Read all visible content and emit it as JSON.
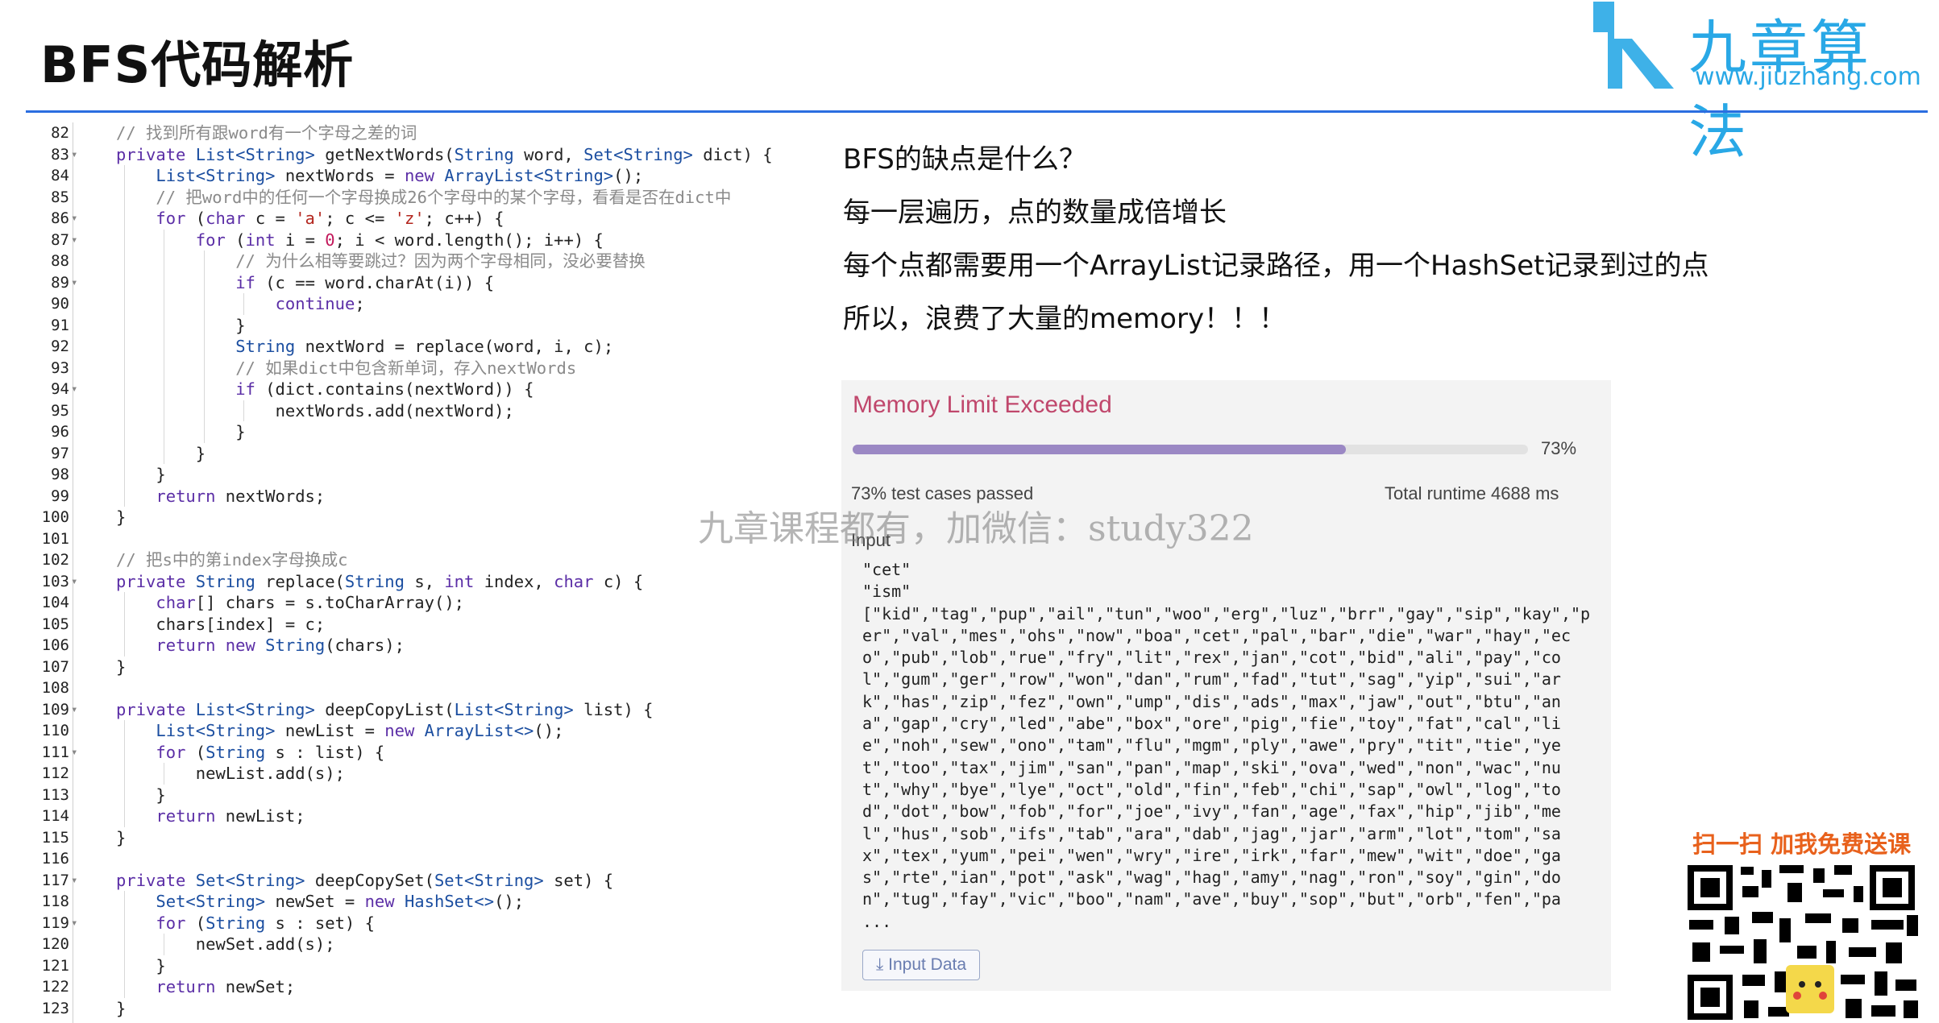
{
  "title": "BFS代码解析",
  "logo": {
    "name_cn": "九章算法",
    "url": "www.jiuzhang.com"
  },
  "code": {
    "lines": [
      {
        "n": "82",
        "fold": false,
        "indent": 1,
        "guides": 0,
        "tokens": [
          [
            "com",
            "// 找到所有跟word有一个字母之差的词"
          ]
        ]
      },
      {
        "n": "83",
        "fold": true,
        "indent": 1,
        "guides": 0,
        "tokens": [
          [
            "kw",
            "private "
          ],
          [
            "ty",
            "List<String> "
          ],
          [
            "",
            "getNextWords("
          ],
          [
            "ty",
            "String "
          ],
          [
            "",
            "word, "
          ],
          [
            "ty",
            "Set<String> "
          ],
          [
            "",
            "dict) {"
          ]
        ]
      },
      {
        "n": "84",
        "fold": false,
        "indent": 2,
        "guides": 1,
        "tokens": [
          [
            "ty",
            "List<String> "
          ],
          [
            "",
            "nextWords = "
          ],
          [
            "kw",
            "new "
          ],
          [
            "ty",
            "ArrayList<String>"
          ],
          [
            "",
            "();"
          ]
        ]
      },
      {
        "n": "85",
        "fold": false,
        "indent": 2,
        "guides": 1,
        "tokens": [
          [
            "com",
            "// 把word中的任何一个字母换成26个字母中的某个字母，看看是否在dict中"
          ]
        ]
      },
      {
        "n": "86",
        "fold": true,
        "indent": 2,
        "guides": 1,
        "tokens": [
          [
            "kw",
            "for "
          ],
          [
            "",
            "("
          ],
          [
            "kw",
            "char "
          ],
          [
            "",
            "c = "
          ],
          [
            "str",
            "'a'"
          ],
          [
            "",
            "; c <= "
          ],
          [
            "str",
            "'z'"
          ],
          [
            "",
            "; c++) {"
          ]
        ]
      },
      {
        "n": "87",
        "fold": true,
        "indent": 3,
        "guides": 2,
        "tokens": [
          [
            "kw",
            "for "
          ],
          [
            "",
            "("
          ],
          [
            "kw",
            "int "
          ],
          [
            "",
            "i = "
          ],
          [
            "num",
            "0"
          ],
          [
            "",
            "; i < word.length(); i++) {"
          ]
        ]
      },
      {
        "n": "88",
        "fold": false,
        "indent": 4,
        "guides": 3,
        "tokens": [
          [
            "com",
            "// 为什么相等要跳过？因为两个字母相同，没必要替换"
          ]
        ]
      },
      {
        "n": "89",
        "fold": true,
        "indent": 4,
        "guides": 3,
        "tokens": [
          [
            "kw",
            "if "
          ],
          [
            "",
            "(c == word.charAt(i)) {"
          ]
        ]
      },
      {
        "n": "90",
        "fold": false,
        "indent": 5,
        "guides": 4,
        "tokens": [
          [
            "kw",
            "continue"
          ],
          [
            "",
            ";"
          ]
        ]
      },
      {
        "n": "91",
        "fold": false,
        "indent": 4,
        "guides": 3,
        "tokens": [
          [
            "",
            "}"
          ]
        ]
      },
      {
        "n": "92",
        "fold": false,
        "indent": 4,
        "guides": 3,
        "tokens": [
          [
            "ty",
            "String "
          ],
          [
            "",
            "nextWord = replace(word, i, c);"
          ]
        ]
      },
      {
        "n": "93",
        "fold": false,
        "indent": 4,
        "guides": 3,
        "tokens": [
          [
            "com",
            "// 如果dict中包含新单词，存入nextWords"
          ]
        ]
      },
      {
        "n": "94",
        "fold": true,
        "indent": 4,
        "guides": 3,
        "tokens": [
          [
            "kw",
            "if "
          ],
          [
            "",
            "(dict.contains(nextWord)) {"
          ]
        ]
      },
      {
        "n": "95",
        "fold": false,
        "indent": 5,
        "guides": 4,
        "tokens": [
          [
            "",
            "nextWords.add(nextWord);"
          ]
        ]
      },
      {
        "n": "96",
        "fold": false,
        "indent": 4,
        "guides": 3,
        "tokens": [
          [
            "",
            "}"
          ]
        ]
      },
      {
        "n": "97",
        "fold": false,
        "indent": 3,
        "guides": 2,
        "tokens": [
          [
            "",
            "}"
          ]
        ]
      },
      {
        "n": "98",
        "fold": false,
        "indent": 2,
        "guides": 1,
        "tokens": [
          [
            "",
            "}"
          ]
        ]
      },
      {
        "n": "99",
        "fold": false,
        "indent": 2,
        "guides": 1,
        "tokens": [
          [
            "kw",
            "return "
          ],
          [
            "",
            "nextWords;"
          ]
        ]
      },
      {
        "n": "100",
        "fold": false,
        "indent": 1,
        "guides": 0,
        "tokens": [
          [
            "",
            "}"
          ]
        ]
      },
      {
        "n": "101",
        "fold": false,
        "indent": 1,
        "guides": 0,
        "tokens": []
      },
      {
        "n": "102",
        "fold": false,
        "indent": 1,
        "guides": 0,
        "tokens": [
          [
            "com",
            "// 把s中的第index字母换成c"
          ]
        ]
      },
      {
        "n": "103",
        "fold": true,
        "indent": 1,
        "guides": 0,
        "tokens": [
          [
            "kw",
            "private "
          ],
          [
            "ty",
            "String "
          ],
          [
            "",
            "replace("
          ],
          [
            "ty",
            "String "
          ],
          [
            "",
            "s, "
          ],
          [
            "kw",
            "int "
          ],
          [
            "",
            "index, "
          ],
          [
            "kw",
            "char "
          ],
          [
            "",
            "c) {"
          ]
        ]
      },
      {
        "n": "104",
        "fold": false,
        "indent": 2,
        "guides": 1,
        "tokens": [
          [
            "kw",
            "char"
          ],
          [
            "",
            "[] chars = s.toCharArray();"
          ]
        ]
      },
      {
        "n": "105",
        "fold": false,
        "indent": 2,
        "guides": 1,
        "tokens": [
          [
            "",
            "chars[index] = c;"
          ]
        ]
      },
      {
        "n": "106",
        "fold": false,
        "indent": 2,
        "guides": 1,
        "tokens": [
          [
            "kw",
            "return new "
          ],
          [
            "ty",
            "String"
          ],
          [
            "",
            "(chars);"
          ]
        ]
      },
      {
        "n": "107",
        "fold": false,
        "indent": 1,
        "guides": 0,
        "tokens": [
          [
            "",
            "}"
          ]
        ]
      },
      {
        "n": "108",
        "fold": false,
        "indent": 1,
        "guides": 0,
        "tokens": []
      },
      {
        "n": "109",
        "fold": true,
        "indent": 1,
        "guides": 0,
        "tokens": [
          [
            "kw",
            "private "
          ],
          [
            "ty",
            "List<String> "
          ],
          [
            "",
            "deepCopyList("
          ],
          [
            "ty",
            "List<String> "
          ],
          [
            "",
            "list) {"
          ]
        ]
      },
      {
        "n": "110",
        "fold": false,
        "indent": 2,
        "guides": 1,
        "tokens": [
          [
            "ty",
            "List<String> "
          ],
          [
            "",
            "newList = "
          ],
          [
            "kw",
            "new "
          ],
          [
            "ty",
            "ArrayList<>"
          ],
          [
            "",
            "();"
          ]
        ]
      },
      {
        "n": "111",
        "fold": true,
        "indent": 2,
        "guides": 1,
        "tokens": [
          [
            "kw",
            "for "
          ],
          [
            "",
            "("
          ],
          [
            "ty",
            "String "
          ],
          [
            "",
            "s : list) {"
          ]
        ]
      },
      {
        "n": "112",
        "fold": false,
        "indent": 3,
        "guides": 2,
        "tokens": [
          [
            "",
            "newList.add(s);"
          ]
        ]
      },
      {
        "n": "113",
        "fold": false,
        "indent": 2,
        "guides": 1,
        "tokens": [
          [
            "",
            "}"
          ]
        ]
      },
      {
        "n": "114",
        "fold": false,
        "indent": 2,
        "guides": 1,
        "tokens": [
          [
            "kw",
            "return "
          ],
          [
            "",
            "newList;"
          ]
        ]
      },
      {
        "n": "115",
        "fold": false,
        "indent": 1,
        "guides": 0,
        "tokens": [
          [
            "",
            "}"
          ]
        ]
      },
      {
        "n": "116",
        "fold": false,
        "indent": 1,
        "guides": 0,
        "tokens": []
      },
      {
        "n": "117",
        "fold": true,
        "indent": 1,
        "guides": 0,
        "tokens": [
          [
            "kw",
            "private "
          ],
          [
            "ty",
            "Set<String> "
          ],
          [
            "",
            "deepCopySet("
          ],
          [
            "ty",
            "Set<String> "
          ],
          [
            "",
            "set) {"
          ]
        ]
      },
      {
        "n": "118",
        "fold": false,
        "indent": 2,
        "guides": 1,
        "tokens": [
          [
            "ty",
            "Set<String> "
          ],
          [
            "",
            "newSet = "
          ],
          [
            "kw",
            "new "
          ],
          [
            "ty",
            "HashSet<>"
          ],
          [
            "",
            "();"
          ]
        ]
      },
      {
        "n": "119",
        "fold": true,
        "indent": 2,
        "guides": 1,
        "tokens": [
          [
            "kw",
            "for "
          ],
          [
            "",
            "("
          ],
          [
            "ty",
            "String "
          ],
          [
            "",
            "s : set) {"
          ]
        ]
      },
      {
        "n": "120",
        "fold": false,
        "indent": 3,
        "guides": 2,
        "tokens": [
          [
            "",
            "newSet.add(s);"
          ]
        ]
      },
      {
        "n": "121",
        "fold": false,
        "indent": 2,
        "guides": 1,
        "tokens": [
          [
            "",
            "}"
          ]
        ]
      },
      {
        "n": "122",
        "fold": false,
        "indent": 2,
        "guides": 1,
        "tokens": [
          [
            "kw",
            "return "
          ],
          [
            "",
            "newSet;"
          ]
        ]
      },
      {
        "n": "123",
        "fold": false,
        "indent": 1,
        "guides": 0,
        "tokens": [
          [
            "",
            "}"
          ]
        ]
      }
    ]
  },
  "questions": [
    "BFS的缺点是什么？",
    "每一层遍历，点的数量成倍增长",
    "每个点都需要用一个ArrayList记录路径，用一个HashSet记录到过的点",
    "所以，浪费了大量的memory！！！"
  ],
  "result": {
    "status": "Memory Limit Exceeded",
    "progress": 0.73,
    "percent_label": "73%",
    "passed_text": "73% test cases passed",
    "runtime_text": "Total runtime 4688 ms",
    "input_label": "Input",
    "input_lines": [
      "\"cet\"",
      "\"ism\"",
      "[\"kid\",\"tag\",\"pup\",\"ail\",\"tun\",\"woo\",\"erg\",\"luz\",\"brr\",\"gay\",\"sip\",\"kay\",\"p",
      "er\",\"val\",\"mes\",\"ohs\",\"now\",\"boa\",\"cet\",\"pal\",\"bar\",\"die\",\"war\",\"hay\",\"ec",
      "o\",\"pub\",\"lob\",\"rue\",\"fry\",\"lit\",\"rex\",\"jan\",\"cot\",\"bid\",\"ali\",\"pay\",\"co",
      "l\",\"gum\",\"ger\",\"row\",\"won\",\"dan\",\"rum\",\"fad\",\"tut\",\"sag\",\"yip\",\"sui\",\"ar",
      "k\",\"has\",\"zip\",\"fez\",\"own\",\"ump\",\"dis\",\"ads\",\"max\",\"jaw\",\"out\",\"btu\",\"an",
      "a\",\"gap\",\"cry\",\"led\",\"abe\",\"box\",\"ore\",\"pig\",\"fie\",\"toy\",\"fat\",\"cal\",\"li",
      "e\",\"noh\",\"sew\",\"ono\",\"tam\",\"flu\",\"mgm\",\"ply\",\"awe\",\"pry\",\"tit\",\"tie\",\"ye",
      "t\",\"too\",\"tax\",\"jim\",\"san\",\"pan\",\"map\",\"ski\",\"ova\",\"wed\",\"non\",\"wac\",\"nu",
      "t\",\"why\",\"bye\",\"lye\",\"oct\",\"old\",\"fin\",\"feb\",\"chi\",\"sap\",\"owl\",\"log\",\"to",
      "d\",\"dot\",\"bow\",\"fob\",\"for\",\"joe\",\"ivy\",\"fan\",\"age\",\"fax\",\"hip\",\"jib\",\"me",
      "l\",\"hus\",\"sob\",\"ifs\",\"tab\",\"ara\",\"dab\",\"jag\",\"jar\",\"arm\",\"lot\",\"tom\",\"sa",
      "x\",\"tex\",\"yum\",\"pei\",\"wen\",\"wry\",\"ire\",\"irk\",\"far\",\"mew\",\"wit\",\"doe\",\"ga",
      "s\",\"rte\",\"ian\",\"pot\",\"ask\",\"wag\",\"hag\",\"amy\",\"nag\",\"ron\",\"soy\",\"gin\",\"do",
      "n\",\"tug\",\"fay\",\"vic\",\"boo\",\"nam\",\"ave\",\"buy\",\"sop\",\"but\",\"orb\",\"fen\",\"pa",
      "..."
    ],
    "input_button": "Input Data"
  },
  "watermark": "九章课程都有，加微信：study322",
  "qr": {
    "title": "扫一扫 加我免费送课"
  },
  "colors": {
    "accent": "#2b6ee0",
    "status": "#c0476c",
    "progress": "#9b88c4",
    "qr_title": "#e8611c",
    "logo": "#29a8e6"
  }
}
